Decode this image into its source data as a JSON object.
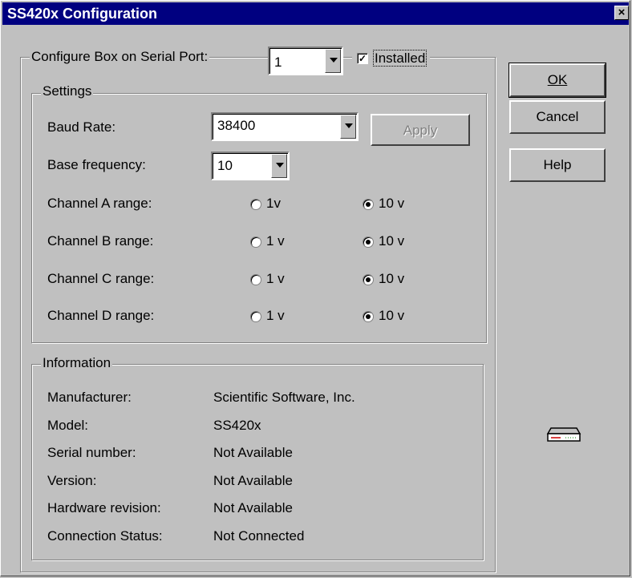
{
  "window": {
    "title": "SS420x Configuration",
    "close_glyph": "×"
  },
  "port": {
    "label": "Configure Box on Serial Port:",
    "value": "1",
    "installed_label": "Installed",
    "installed": true
  },
  "buttons": {
    "ok": "OK",
    "cancel": "Cancel",
    "help": "Help"
  },
  "settings": {
    "title": "Settings",
    "baud_label": "Baud Rate:",
    "baud_value": "38400",
    "apply_label": "Apply",
    "base_freq_label": "Base frequency:",
    "base_freq_value": "10",
    "channels": [
      {
        "label": "Channel A range:",
        "opt1": "1v",
        "opt2": "10 v",
        "selected": "10 v"
      },
      {
        "label": "Channel B range:",
        "opt1": "1 v",
        "opt2": "10 v",
        "selected": "10 v"
      },
      {
        "label": "Channel C range:",
        "opt1": "1 v",
        "opt2": "10 v",
        "selected": "10 v"
      },
      {
        "label": "Channel D range:",
        "opt1": "1 v",
        "opt2": "10 v",
        "selected": "10 v"
      }
    ]
  },
  "information": {
    "title": "Information",
    "rows": [
      {
        "label": "Manufacturer:",
        "value": "Scientific Software, Inc."
      },
      {
        "label": "Model:",
        "value": "SS420x"
      },
      {
        "label": "Serial number:",
        "value": "Not Available"
      },
      {
        "label": "Version:",
        "value": "Not Available"
      },
      {
        "label": "Hardware revision:",
        "value": "Not Available"
      },
      {
        "label": "Connection Status:",
        "value": "Not Connected"
      }
    ]
  },
  "icons": {
    "device": "device-box-icon"
  }
}
